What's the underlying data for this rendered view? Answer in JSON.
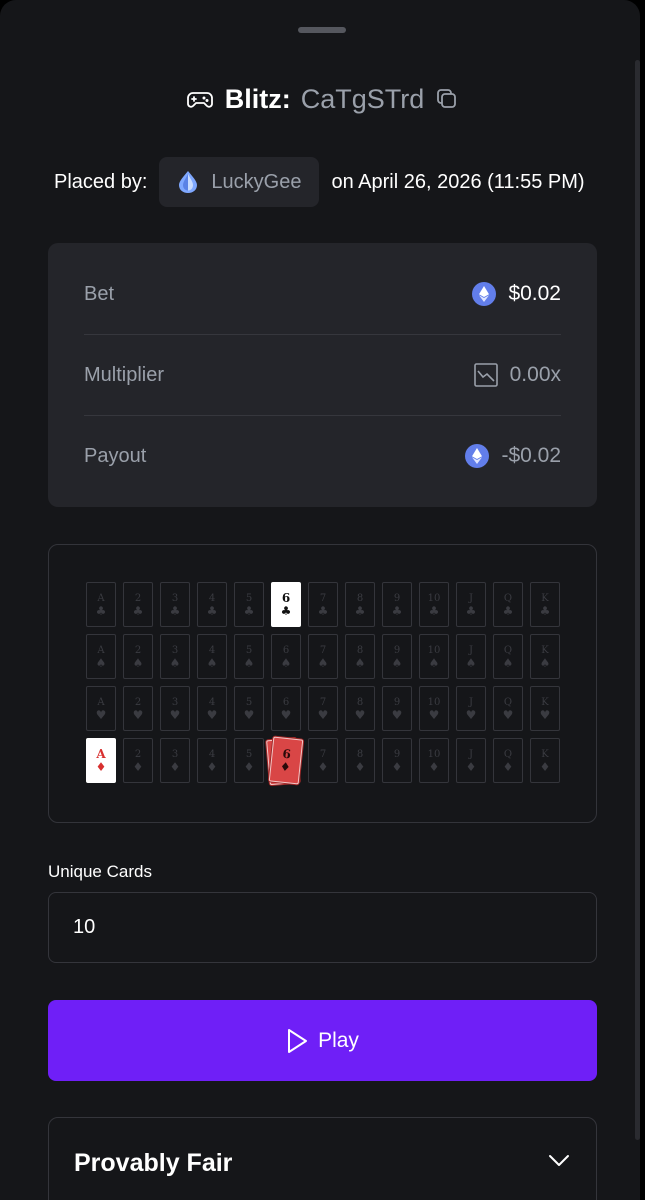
{
  "header": {
    "game_name": "Blitz:",
    "bet_id": "CaTgSTrd"
  },
  "placed": {
    "prefix": "Placed by:",
    "username": "LuckyGee",
    "date": "on April 26, 2026 (11:55 PM)"
  },
  "stats": [
    {
      "label": "Bet",
      "value": "$0.02",
      "icon": "eth-icon"
    },
    {
      "label": "Multiplier",
      "value": "0.00x",
      "icon": "chart-icon"
    },
    {
      "label": "Payout",
      "value": "-$0.02",
      "icon": "eth-icon"
    }
  ],
  "deck": {
    "ranks": [
      "A",
      "2",
      "3",
      "4",
      "5",
      "6",
      "7",
      "8",
      "9",
      "10",
      "J",
      "Q",
      "K"
    ],
    "suits": [
      "♣",
      "♠",
      "♥",
      "♦"
    ],
    "drawn": [
      {
        "rank": "6",
        "suit": "♣",
        "row": 0,
        "col": 5,
        "style": "white"
      },
      {
        "rank": "A",
        "suit": "♦",
        "row": 3,
        "col": 0,
        "style": "white-red"
      },
      {
        "rank": "6",
        "suit": "♦",
        "row": 3,
        "col": 5,
        "style": "stacked"
      }
    ]
  },
  "unique_cards": {
    "label": "Unique Cards",
    "value": "10"
  },
  "play_button": {
    "label": "Play"
  },
  "provably_fair": {
    "title": "Provably Fair"
  },
  "colors": {
    "background": "#151619",
    "panel": "#24252a",
    "accent": "#6f1ff7",
    "eth": "#627eea",
    "red_card": "#d94646"
  }
}
